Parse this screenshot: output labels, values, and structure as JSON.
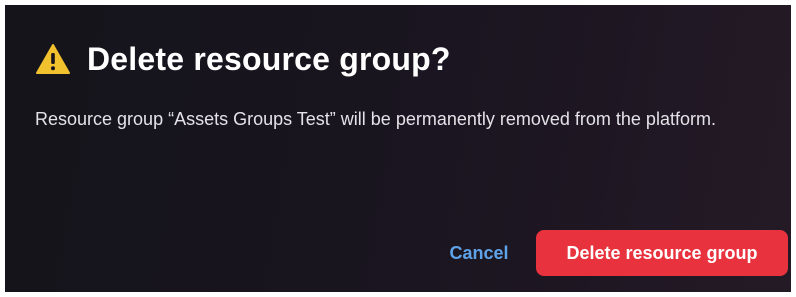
{
  "dialog": {
    "title": "Delete resource group?",
    "icon": "warning-triangle-icon",
    "message": "Resource group “Assets Groups Test” will be permanently removed from the platform.",
    "cancel_label": "Cancel",
    "confirm_label": "Delete resource group"
  },
  "colors": {
    "warning": "#f2c12e",
    "danger": "#e8323e",
    "link": "#5ea2e8",
    "background": "#17141c"
  }
}
